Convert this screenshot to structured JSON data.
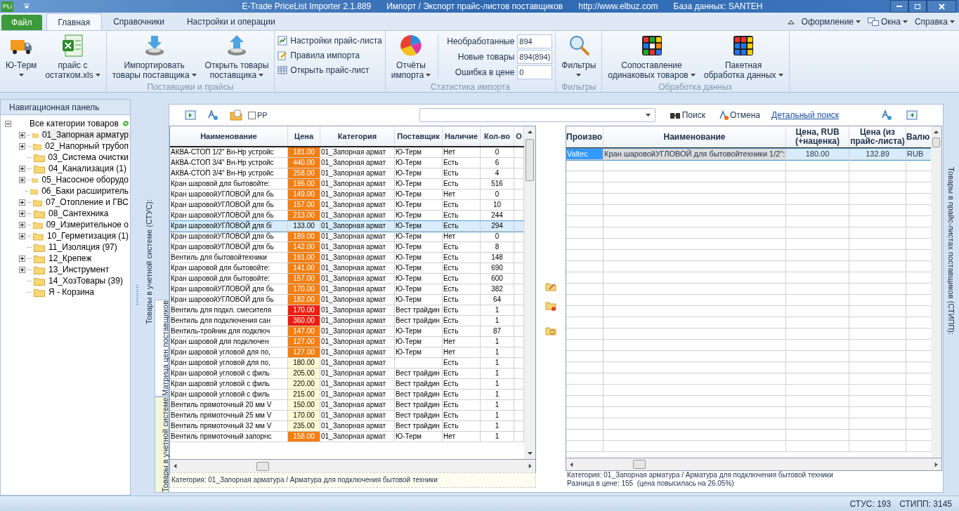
{
  "window": {
    "app_icon": "PLi",
    "title": "E-Trade PriceList Importer 2.1.889",
    "subtitle": "Импорт / Экспорт прайс-листов поставщиков",
    "url": "http://www.elbuz.com",
    "database": "База данных: SANTEH"
  },
  "ribbon": {
    "file_tab": "Файл",
    "tabs": [
      {
        "label": "Главная",
        "selected": true
      },
      {
        "label": "Справочники",
        "selected": false
      },
      {
        "label": "Настройки и операции",
        "selected": false
      }
    ],
    "menus": [
      "Оформление",
      "Окна",
      "Справка"
    ],
    "groups": [
      {
        "items": [
          {
            "kind": "large",
            "lines": [
              "Ю-Терм"
            ],
            "dropdown": true
          },
          {
            "kind": "large",
            "lines": [
              "прайс с",
              "остатком.xls"
            ],
            "dropdown": true
          }
        ]
      },
      {
        "title": "Поставщики и прайсы",
        "items": [
          {
            "kind": "large",
            "lines": [
              "Импортировать",
              "товары поставщика"
            ],
            "dropdown": true
          },
          {
            "kind": "large",
            "lines": [
              "Открыть товары",
              "поставщика"
            ],
            "dropdown": true
          }
        ]
      },
      {
        "items": [
          {
            "kind": "small",
            "labels": [
              "Настройки прайс-листа",
              "Правила импорта",
              "Открыть прайс-лист"
            ]
          }
        ]
      },
      {
        "title": "Статистика импорта",
        "items": [
          {
            "kind": "large",
            "lines": [
              "Отчёты",
              "импорта"
            ],
            "dropdown": true
          },
          {
            "kind": "stats",
            "rows": [
              {
                "label": "Необработанные",
                "value": "894"
              },
              {
                "label": "Новые товары",
                "value": "894(894)"
              },
              {
                "label": "Ошибка в цене",
                "value": "0"
              }
            ]
          }
        ]
      },
      {
        "title": "Фильтры",
        "items": [
          {
            "kind": "large",
            "lines": [
              "Фильтры"
            ],
            "dropdown": true
          }
        ]
      },
      {
        "title": "Обработка данных",
        "items": [
          {
            "kind": "large",
            "lines": [
              "Сопоставление",
              "одинаковых товаров"
            ],
            "dropdown": true
          },
          {
            "kind": "large",
            "lines": [
              "Пакетная",
              "обработка данных"
            ],
            "dropdown": true
          }
        ]
      }
    ]
  },
  "navigation": {
    "title": "Навигационная панель",
    "tree": {
      "label": "Все категории товаров",
      "expanded": true,
      "children": [
        {
          "label": "01_Запорная арматур",
          "expandable": true,
          "selected": true
        },
        {
          "label": "02_Напорный трубоп",
          "expandable": true,
          "selected": false
        },
        {
          "label": "03_Система очистки",
          "expandable": false,
          "selected": false
        },
        {
          "label": "04_Канализация (1)",
          "expandable": true,
          "selected": false
        },
        {
          "label": "05_Насосное оборудо",
          "expandable": true,
          "selected": false
        },
        {
          "label": "06_Баки расширитель",
          "expandable": false,
          "selected": false
        },
        {
          "label": "07_Отопление и ГВС",
          "expandable": true,
          "selected": false
        },
        {
          "label": "08_Сантехника",
          "expandable": true,
          "selected": false
        },
        {
          "label": "09_Измерительное о",
          "expandable": true,
          "selected": false
        },
        {
          "label": "10_Герметизация (1)",
          "expandable": true,
          "selected": false
        },
        {
          "label": "11_Изоляция (97)",
          "expandable": false,
          "selected": false
        },
        {
          "label": "12_Крепеж",
          "expandable": true,
          "selected": false
        },
        {
          "label": "13_Инструмент",
          "expandable": true,
          "selected": false
        },
        {
          "label": "14_ХозТовары (39)",
          "expandable": false,
          "selected": false
        },
        {
          "label": "Я - Корзина",
          "expandable": false,
          "selected": false
        }
      ]
    }
  },
  "side_label": "Товары в учетной системе (СТУС):",
  "side_tabs": [
    {
      "label": "Матрица цен поставщиков",
      "selected": true
    },
    {
      "label": "Товары в учетной системе",
      "selected": false
    }
  ],
  "toolbar": {
    "checkbox": {
      "label": "PP",
      "checked": false
    },
    "search_button": "Поиск",
    "cancel_button": "Отмена",
    "link": "Детальный поиск"
  },
  "left_table": {
    "columns": [
      "Наименование",
      "Цена",
      "Категория",
      "Поставщик",
      "Наличие",
      "Кол-во",
      "О"
    ],
    "rows": [
      {
        "cells": [
          "АКВА-СТОП 1/2\" Вн-Нр устройс",
          "181.00",
          "01_Запорная армат",
          "Ю-Терм",
          "Нет",
          "0"
        ],
        "color": "#f57e0f",
        "selected": false
      },
      {
        "cells": [
          "АКВА-СТОП 3/4\" Вн-Нр устройс",
          "440.00",
          "01_Запорная армат",
          "Ю-Терм",
          "Есть",
          "6"
        ],
        "color": "#f57e0f",
        "selected": false
      },
      {
        "cells": [
          "АКВА-СТОП 3/4\" Вн-Нр устройс",
          "258.00",
          "01_Запорная армат",
          "Ю-Терм",
          "Есть",
          "4"
        ],
        "color": "#f57e0f",
        "selected": false
      },
      {
        "cells": [
          "Кран шаровой для бытовойте:",
          "195.00",
          "01_Запорная армат",
          "Ю-Терм",
          "Есть",
          "516"
        ],
        "color": "#f57e0f",
        "selected": false
      },
      {
        "cells": [
          "Кран шаровойУГЛОВОЙ для бь",
          "149.00",
          "01_Запорная армат",
          "Ю-Терм",
          "Нет",
          "0"
        ],
        "color": "#f57e0f",
        "selected": false
      },
      {
        "cells": [
          "Кран шаровойУГЛОВОЙ для бь",
          "157.00",
          "01_Запорная армат",
          "Ю-Терм",
          "Есть",
          "10"
        ],
        "color": "#f57e0f",
        "selected": false
      },
      {
        "cells": [
          "Кран шаровойУГЛОВОЙ для бь",
          "213.00",
          "01_Запорная армат",
          "Ю-Терм",
          "Есть",
          "244"
        ],
        "color": "#f57e0f",
        "selected": false
      },
      {
        "cells": [
          "Кран шаровойУГЛОВОЙ для бі",
          "133.00",
          "01_Запорная армат",
          "Ю-Терм",
          "Есть",
          "294"
        ],
        "selected": true
      },
      {
        "cells": [
          "Кран шаровойУГЛОВОЙ для бь",
          "189.00",
          "01_Запорная армат",
          "Ю-Терм",
          "Нет",
          "0"
        ],
        "color": "#f57e0f",
        "selected": false
      },
      {
        "cells": [
          "Кран шаровойУГЛОВОЙ для бь",
          "142.00",
          "01_Запорная армат",
          "Ю-Терм",
          "Есть",
          "8"
        ],
        "color": "#f57e0f",
        "selected": false
      },
      {
        "cells": [
          "Вентиль для бытовойтехники",
          "191.00",
          "01_Запорная армат",
          "Ю-Терм",
          "Есть",
          "148"
        ],
        "color": "#f57e0f",
        "selected": false
      },
      {
        "cells": [
          "Кран шаровой для бытовойте:",
          "141.00",
          "01_Запорная армат",
          "Ю-Терм",
          "Есть",
          "690"
        ],
        "color": "#f57e0f",
        "selected": false
      },
      {
        "cells": [
          "Кран шаровой для бытовойте:",
          "157.00",
          "01_Запорная армат",
          "Ю-Терм",
          "Есть",
          "600"
        ],
        "color": "#f57e0f",
        "selected": false
      },
      {
        "cells": [
          "Кран шаровойУГЛОВОЙ для бь",
          "170.00",
          "01_Запорная армат",
          "Ю-Терм",
          "Есть",
          "382"
        ],
        "color": "#f57e0f",
        "selected": false
      },
      {
        "cells": [
          "Кран шаровойУГЛОВОЙ для бь",
          "182.00",
          "01_Запорная армат",
          "Ю-Терм",
          "Есть",
          "64"
        ],
        "color": "#f57e0f",
        "selected": false
      },
      {
        "cells": [
          "Вентиль для подкл. смесителя",
          "170.00",
          "01_Запорная армат",
          "Вест трайдин",
          "Есть",
          "1"
        ],
        "color": "#ee1c0e",
        "selected": false
      },
      {
        "cells": [
          "Вентиль для подключения сан",
          "360.00",
          "01_Запорная армат",
          "Вест трайдин",
          "Есть",
          "1"
        ],
        "color": "#ee1c0e",
        "selected": false
      },
      {
        "cells": [
          "Вентиль-тройник для подключ",
          "147.00",
          "01_Запорная армат",
          "Ю-Терм",
          "Есть",
          "87"
        ],
        "color": "#f57e0f",
        "selected": false
      },
      {
        "cells": [
          "Кран шаровой для подключен",
          "127.00",
          "01_Запорная армат",
          "Ю-Терм",
          "Нет",
          "1"
        ],
        "color": "#f57e0f",
        "selected": false
      },
      {
        "cells": [
          "Кран шаровой угловой для по,",
          "127.00",
          "01_Запорная армат",
          "Ю-Терм",
          "Нет",
          "1"
        ],
        "color": "#f57e0f",
        "selected": false
      },
      {
        "cells": [
          "Кран шаровой угловой для по,",
          "180.00",
          "01_Запорная армат",
          "",
          "Есть",
          "1"
        ],
        "color": "#fffbd2",
        "selected": false
      },
      {
        "cells": [
          "Кран шаровой угловой с филь",
          "205.00",
          "01_Запорная армат",
          "Вест трайдин",
          "Есть",
          "1"
        ],
        "color": "#fffbd2",
        "selected": false
      },
      {
        "cells": [
          "Кран шаровой угловой с филь",
          "220.00",
          "01_Запорная армат",
          "Вест трайдин",
          "Есть",
          "1"
        ],
        "color": "#fffbd2",
        "selected": false
      },
      {
        "cells": [
          "Кран шаровой угловой с филь",
          "215.00",
          "01_Запорная армат",
          "Вест трайдин",
          "Есть",
          "1"
        ],
        "color": "#fffbd2",
        "selected": false
      },
      {
        "cells": [
          "Вентиль прямоточный 20 мм V",
          "150.00",
          "01_Запорная армат",
          "Вест трайдин",
          "Есть",
          "1"
        ],
        "color": "#fffbd2",
        "selected": false
      },
      {
        "cells": [
          "Вентиль прямоточный 25 мм V",
          "170.00",
          "01_Запорная армат",
          "Вест трайдин",
          "Есть",
          "1"
        ],
        "color": "#fffbd2",
        "selected": false
      },
      {
        "cells": [
          "Вентиль прямоточный 32 мм V",
          "235.00",
          "01_Запорная армат",
          "Вест трайдин",
          "Есть",
          "1"
        ],
        "color": "#fffbd2",
        "selected": false
      },
      {
        "cells": [
          "Вентиль прямоточный запорнс",
          "158.00",
          "01_Запорная армат",
          "Ю-Терм",
          "Нет",
          "1"
        ],
        "color": "#f57e0f",
        "selected": false
      }
    ],
    "footer": "Категория: 01_Запорная арматура / Арматура для подключения бытовой техники"
  },
  "right_label": "Товары в прайс-листах поставщиков (СТИПП):",
  "right_table": {
    "columns": [
      "Произво",
      "Наименование",
      "Цена, RUB (+наценка)",
      "Цена (из прайс-листа)",
      "Валю"
    ],
    "rows": [
      {
        "cells": [
          "Valtec",
          "Кран шаровойУГЛОВОЙ для бытовойтехники 1/2\":",
          "180.00",
          "132.89",
          "RUB"
        ],
        "selected": true
      }
    ],
    "footer": [
      "Категория: 01_Запорная арматура / Арматура для подключения бытовой техники",
      "Разница в цене: 155  (цена повысилась на 26.05%)"
    ]
  },
  "status_bar": [
    "СТУС: 193",
    "СТИПП: 3145"
  ]
}
